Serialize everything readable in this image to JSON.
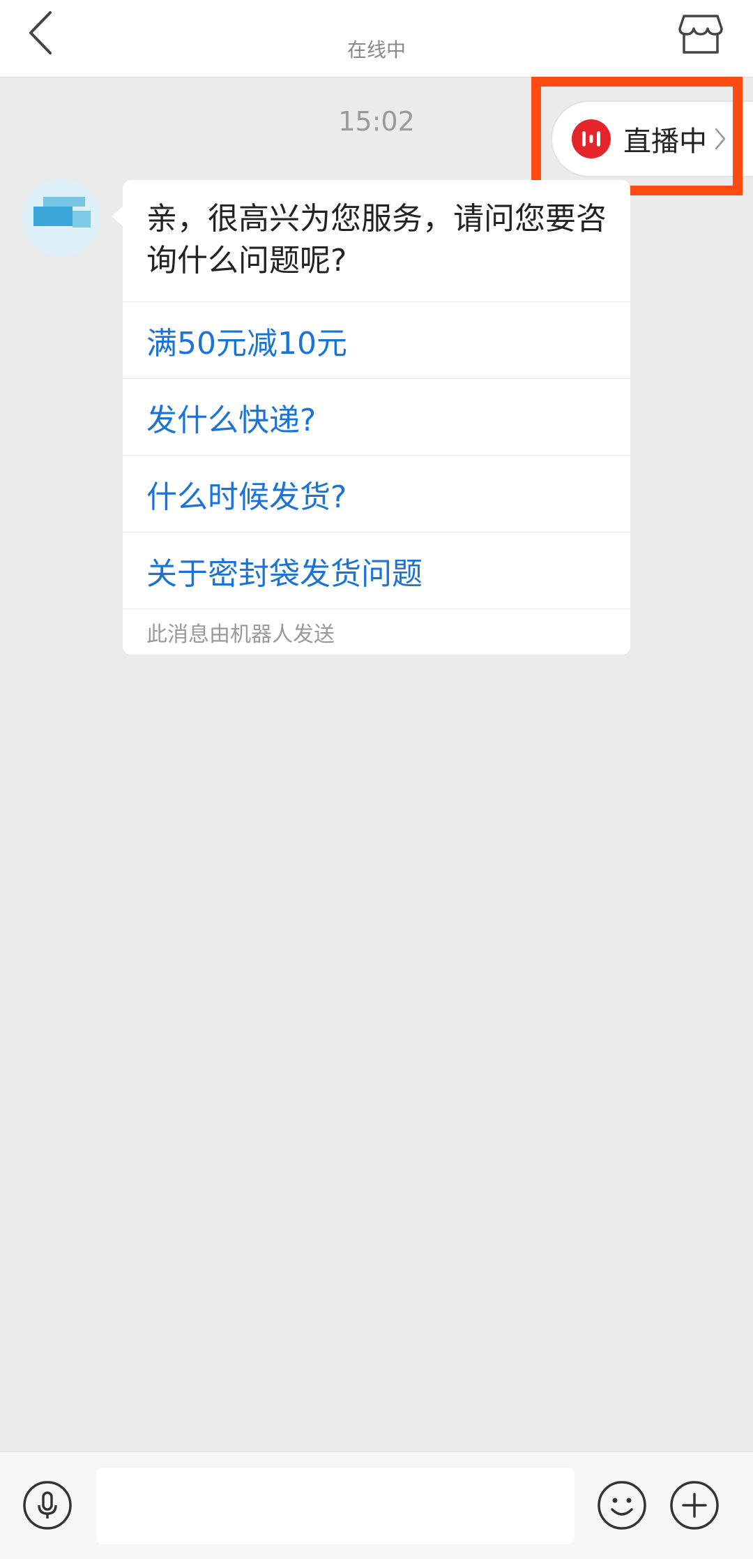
{
  "header": {
    "status": "在线中"
  },
  "live": {
    "label": "直播中",
    "accent_color": "#e6252a",
    "highlight_color": "#ff4a12"
  },
  "chat": {
    "timestamp": "15:02",
    "message": {
      "greeting": "亲，很高兴为您服务，请问您要咨询什么问题呢?",
      "options": [
        "满50元减10元",
        "发什么快递?",
        "什么时候发货?",
        "关于密封袋发货问题"
      ],
      "footer": "此消息由机器人发送"
    },
    "link_color": "#1a73d9"
  },
  "input": {
    "placeholder": ""
  },
  "icons": {
    "back": "chevron-left-icon",
    "store": "store-icon",
    "live": "live-broadcast-icon",
    "voice": "microphone-icon",
    "emoji": "smiley-icon",
    "plus": "plus-icon"
  }
}
